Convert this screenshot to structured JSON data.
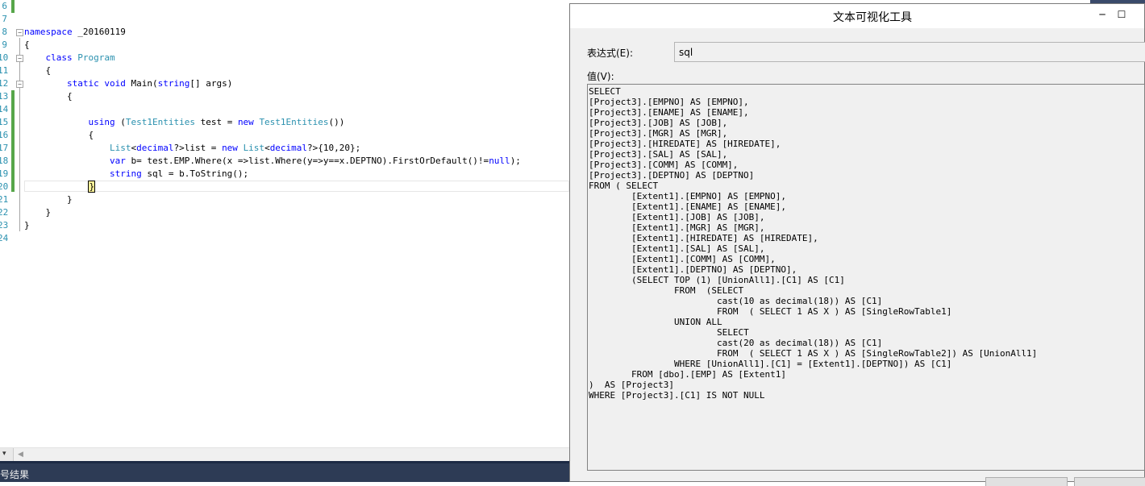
{
  "editor": {
    "lines": [
      {
        "n": "6",
        "tokens": []
      },
      {
        "n": "7",
        "tokens": []
      },
      {
        "n": "8",
        "tokens": [
          {
            "t": "namespace",
            "c": "kw"
          },
          {
            "t": " _20160119",
            "c": ""
          }
        ]
      },
      {
        "n": "9",
        "tokens": [
          {
            "t": "{",
            "c": ""
          }
        ]
      },
      {
        "n": "10",
        "tokens": [
          {
            "t": "    ",
            "c": ""
          },
          {
            "t": "class",
            "c": "kw"
          },
          {
            "t": " ",
            "c": ""
          },
          {
            "t": "Program",
            "c": "ty"
          }
        ]
      },
      {
        "n": "11",
        "tokens": [
          {
            "t": "    {",
            "c": ""
          }
        ]
      },
      {
        "n": "12",
        "tokens": [
          {
            "t": "        ",
            "c": ""
          },
          {
            "t": "static",
            "c": "kw"
          },
          {
            "t": " ",
            "c": ""
          },
          {
            "t": "void",
            "c": "kw"
          },
          {
            "t": " Main(",
            "c": ""
          },
          {
            "t": "string",
            "c": "kw"
          },
          {
            "t": "[] args)",
            "c": ""
          }
        ]
      },
      {
        "n": "13",
        "tokens": [
          {
            "t": "        {",
            "c": ""
          }
        ]
      },
      {
        "n": "14",
        "tokens": []
      },
      {
        "n": "15",
        "tokens": [
          {
            "t": "            ",
            "c": ""
          },
          {
            "t": "using",
            "c": "kw"
          },
          {
            "t": " (",
            "c": ""
          },
          {
            "t": "Test1Entities",
            "c": "ty"
          },
          {
            "t": " test = ",
            "c": ""
          },
          {
            "t": "new",
            "c": "kw"
          },
          {
            "t": " ",
            "c": ""
          },
          {
            "t": "Test1Entities",
            "c": "ty"
          },
          {
            "t": "())",
            "c": ""
          }
        ]
      },
      {
        "n": "16",
        "tokens": [
          {
            "t": "            {",
            "c": ""
          }
        ]
      },
      {
        "n": "17",
        "tokens": [
          {
            "t": "                ",
            "c": ""
          },
          {
            "t": "List",
            "c": "ty"
          },
          {
            "t": "<",
            "c": ""
          },
          {
            "t": "decimal",
            "c": "kw"
          },
          {
            "t": "?>list = ",
            "c": ""
          },
          {
            "t": "new",
            "c": "kw"
          },
          {
            "t": " ",
            "c": ""
          },
          {
            "t": "List",
            "c": "ty"
          },
          {
            "t": "<",
            "c": ""
          },
          {
            "t": "decimal",
            "c": "kw"
          },
          {
            "t": "?>{10,20};",
            "c": ""
          }
        ]
      },
      {
        "n": "18",
        "tokens": [
          {
            "t": "                ",
            "c": ""
          },
          {
            "t": "var",
            "c": "kw"
          },
          {
            "t": " b= test.EMP.Where(x =>list.Where(y=>y==x.DEPTNO).FirstOrDefault()!=",
            "c": ""
          },
          {
            "t": "null",
            "c": "kw"
          },
          {
            "t": ");",
            "c": ""
          }
        ]
      },
      {
        "n": "19",
        "tokens": [
          {
            "t": "                ",
            "c": ""
          },
          {
            "t": "string",
            "c": "kw"
          },
          {
            "t": " sql = b.ToString();",
            "c": ""
          }
        ]
      },
      {
        "n": "20",
        "tokens": [
          {
            "t": "            ",
            "c": ""
          },
          {
            "t": "}",
            "c": "caret"
          }
        ]
      },
      {
        "n": "21",
        "tokens": [
          {
            "t": "        }",
            "c": ""
          }
        ]
      },
      {
        "n": "22",
        "tokens": [
          {
            "t": "    }",
            "c": ""
          }
        ]
      },
      {
        "n": "23",
        "tokens": [
          {
            "t": "}",
            "c": ""
          }
        ]
      },
      {
        "n": "24",
        "tokens": []
      }
    ]
  },
  "statusbar": {
    "output_tab": "号结果"
  },
  "dialog": {
    "title": "文本可视化工具",
    "minimize_glyph": "─",
    "maximize_glyph": "☐",
    "expression_label": "表达式(E):",
    "expression_value": "sql",
    "value_label": "值(V):",
    "value_text": "SELECT \n[Project3].[EMPNO] AS [EMPNO], \n[Project3].[ENAME] AS [ENAME], \n[Project3].[JOB] AS [JOB], \n[Project3].[MGR] AS [MGR], \n[Project3].[HIREDATE] AS [HIREDATE], \n[Project3].[SAL] AS [SAL], \n[Project3].[COMM] AS [COMM], \n[Project3].[DEPTNO] AS [DEPTNO]\nFROM ( SELECT \n\t[Extent1].[EMPNO] AS [EMPNO], \n\t[Extent1].[ENAME] AS [ENAME], \n\t[Extent1].[JOB] AS [JOB], \n\t[Extent1].[MGR] AS [MGR], \n\t[Extent1].[HIREDATE] AS [HIREDATE], \n\t[Extent1].[SAL] AS [SAL], \n\t[Extent1].[COMM] AS [COMM], \n\t[Extent1].[DEPTNO] AS [DEPTNO], \n\t(SELECT TOP (1) [UnionAll1].[C1] AS [C1]\n\t\tFROM  (SELECT \n\t\t\tcast(10 as decimal(18)) AS [C1]\n\t\t\tFROM  ( SELECT 1 AS X ) AS [SingleRowTable1]\n\t\tUNION ALL\n\t\t\tSELECT \n\t\t\tcast(20 as decimal(18)) AS [C1]\n\t\t\tFROM  ( SELECT 1 AS X ) AS [SingleRowTable2]) AS [UnionAll1]\n\t\tWHERE [UnionAll1].[C1] = [Extent1].[DEPTNO]) AS [C1]\n\tFROM [dbo].[EMP] AS [Extent1]\n)  AS [Project3]\nWHERE [Project3].[C1] IS NOT NULL"
  }
}
